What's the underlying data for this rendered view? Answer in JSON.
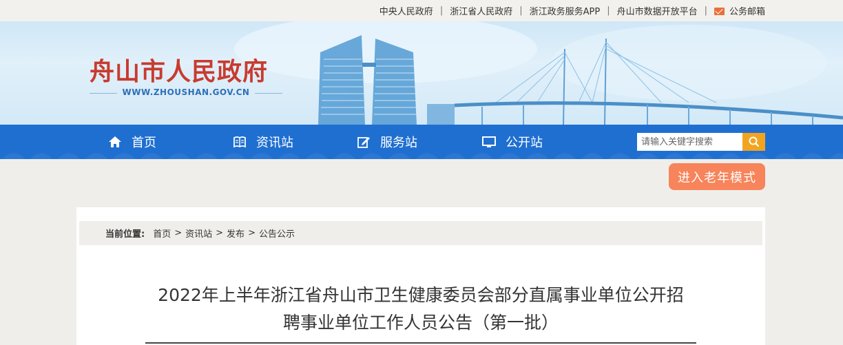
{
  "topbar": {
    "links": [
      "中央人民政府",
      "浙江省人民政府",
      "浙江政务服务APP",
      "舟山市数据开放平台"
    ],
    "mail_label": "公务邮箱",
    "separator": "|"
  },
  "banner": {
    "title": "舟山市人民政府",
    "url": "WWW.ZHOUSHAN.GOV.CN"
  },
  "nav": {
    "items": [
      {
        "label": "首页",
        "icon": "home-icon"
      },
      {
        "label": "资讯站",
        "icon": "book-icon"
      },
      {
        "label": "服务站",
        "icon": "edit-icon"
      },
      {
        "label": "公开站",
        "icon": "monitor-icon"
      }
    ],
    "search_placeholder": "请输入关键字搜索",
    "search_icon": "search-icon"
  },
  "elder_mode_label": "进入老年模式",
  "breadcrumb": {
    "label": "当前位置:",
    "items": [
      "首页",
      "资讯站",
      "发布",
      "公告公示"
    ],
    "separator": ">"
  },
  "article": {
    "title_line1": "2022年上半年浙江省舟山市卫生健康委员会部分直属事业单位公开招",
    "title_line2": "聘事业单位工作人员公告（第一批）"
  },
  "colors": {
    "nav_bg": "#1f6fd1",
    "title_red": "#c83b2f",
    "search_btn": "#f2a41e",
    "elder_btn": "#f7845a"
  }
}
